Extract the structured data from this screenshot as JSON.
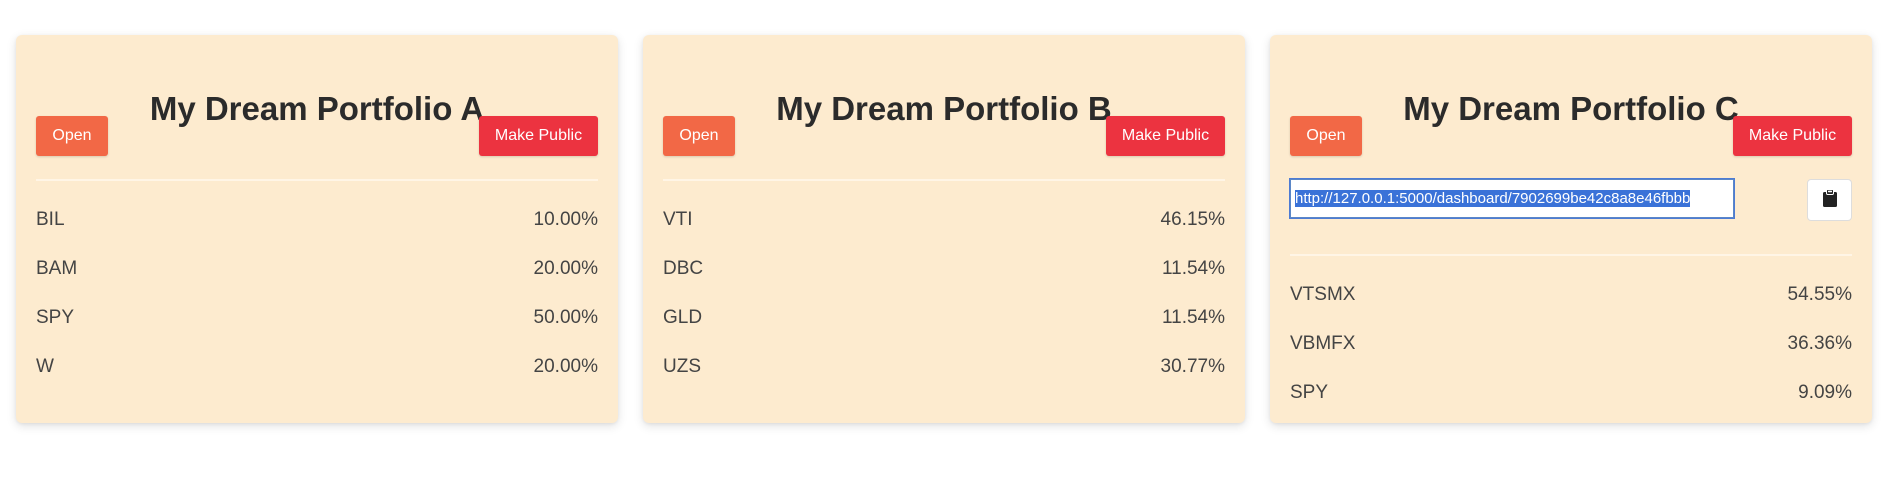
{
  "portfolios": [
    {
      "title": "My Dream Portfolio A",
      "open_label": "Open",
      "public_label": "Make Public",
      "holdings": [
        {
          "ticker": "BIL",
          "weight": "10.00%"
        },
        {
          "ticker": "BAM",
          "weight": "20.00%"
        },
        {
          "ticker": "SPY",
          "weight": "50.00%"
        },
        {
          "ticker": "W",
          "weight": "20.00%"
        }
      ]
    },
    {
      "title": "My Dream Portfolio B",
      "open_label": "Open",
      "public_label": "Make Public",
      "holdings": [
        {
          "ticker": "VTI",
          "weight": "46.15%"
        },
        {
          "ticker": "DBC",
          "weight": "11.54%"
        },
        {
          "ticker": "GLD",
          "weight": "11.54%"
        },
        {
          "ticker": "UZS",
          "weight": "30.77%"
        }
      ]
    },
    {
      "title": "My Dream Portfolio C",
      "open_label": "Open",
      "public_label": "Make Public",
      "share_url": "http://127.0.0.1:5000/dashboard/7902699be42c8a8e46fbbb",
      "copy_icon": "clipboard-icon",
      "holdings": [
        {
          "ticker": "VTSMX",
          "weight": "54.55%"
        },
        {
          "ticker": "VBMFX",
          "weight": "36.36%"
        },
        {
          "ticker": "SPY",
          "weight": "9.09%"
        }
      ]
    }
  ],
  "colors": {
    "card_bg": "#fdebcf",
    "open_button": "#f26846",
    "public_button": "#ec3340",
    "selection": "#3a72d8"
  }
}
